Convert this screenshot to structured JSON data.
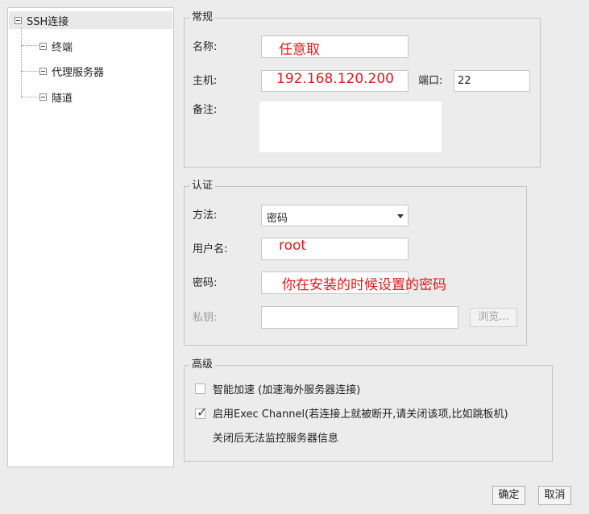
{
  "tree": {
    "root": {
      "label": "SSH连接"
    },
    "children": [
      {
        "label": "终端"
      },
      {
        "label": "代理服务器"
      },
      {
        "label": "隧道"
      }
    ]
  },
  "general": {
    "title": "常规",
    "name_label": "名称:",
    "name_value": "任意取",
    "host_label": "主机:",
    "host_value": "192.168.120.200",
    "port_label": "端口:",
    "port_value": "22",
    "note_label": "备注:",
    "note_value": ""
  },
  "auth": {
    "title": "认证",
    "method_label": "方法:",
    "method_value": "密码",
    "username_label": "用户名:",
    "username_value": "root",
    "password_label": "密码:",
    "password_value": "你在安装的时候设置的密码",
    "key_label": "私钥:",
    "key_value": "",
    "browse_label": "浏览..."
  },
  "advanced": {
    "title": "高级",
    "accel_label": "智能加速 (加速海外服务器连接)",
    "accel_checked": false,
    "exec_label": "启用Exec Channel(若连接上就被断开,请关闭该项,比如跳板机)",
    "exec_checked": true,
    "exec_note": "关闭后无法监控服务器信息"
  },
  "buttons": {
    "ok_label": "确定",
    "cancel_label": "取消"
  },
  "colors": {
    "annotation_red": "#e01a1a",
    "background": "#ececec"
  }
}
